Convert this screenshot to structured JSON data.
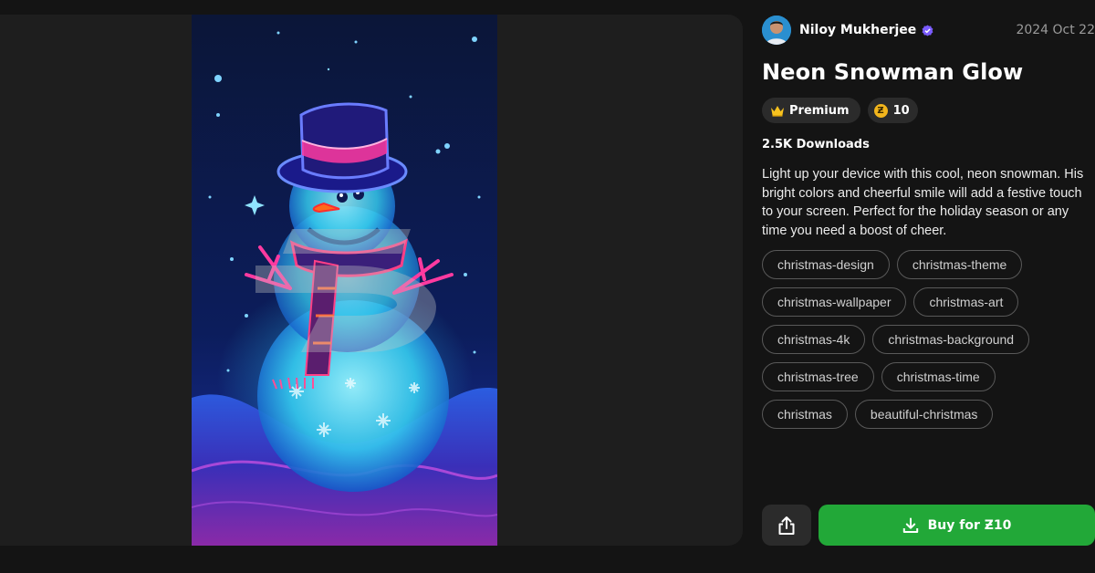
{
  "author": {
    "name": "Niloy Mukherjee",
    "date": "2024 Oct 22"
  },
  "wallpaper": {
    "title": "Neon Snowman Glow",
    "tier": "Premium",
    "price_coins": "10",
    "downloads": "2.5K Downloads",
    "description": "Light up your device with this cool, neon snowman. His bright colors and cheerful smile will add a festive touch to your screen. Perfect for the holiday season or any time you need a boost of cheer.",
    "tags": [
      [
        "christmas-design",
        "christmas-theme"
      ],
      [
        "christmas-wallpaper",
        "christmas-art"
      ],
      [
        "christmas-4k",
        "christmas-background"
      ],
      [
        "christmas-tree",
        "christmas-time"
      ],
      [
        "christmas",
        "beautiful-christmas"
      ]
    ]
  },
  "actions": {
    "buy_label": "Buy for Ƶ10"
  },
  "icons": {
    "verified": "verified-badge-icon",
    "premium": "crown-icon",
    "coin": "coin-icon",
    "share": "share-icon",
    "download": "download-icon"
  },
  "colors": {
    "background": "#141414",
    "panel": "#1e1e1e",
    "chip": "#2b2b2b",
    "buy_button": "#22a838",
    "verified": "#7b5cff",
    "coin": "#f2b51c"
  }
}
